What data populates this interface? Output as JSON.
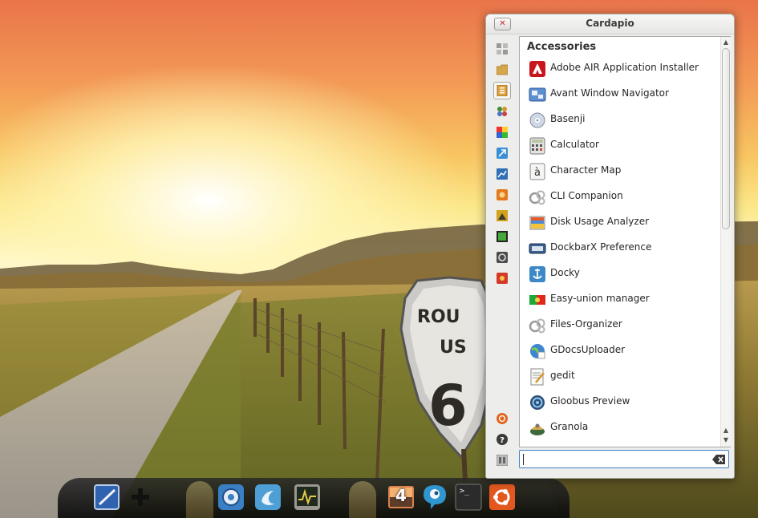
{
  "window": {
    "title": "Cardapio",
    "close_icon": "close-icon"
  },
  "categories": [
    {
      "name": "favorites",
      "icon": "favorites-icon"
    },
    {
      "name": "places",
      "icon": "folder-icon"
    },
    {
      "name": "accessories",
      "icon": "accessories-icon",
      "active": true
    },
    {
      "name": "education",
      "icon": "education-icon"
    },
    {
      "name": "graphics",
      "icon": "graphics-icon"
    },
    {
      "name": "internet",
      "icon": "internet-icon"
    },
    {
      "name": "office",
      "icon": "office-icon"
    },
    {
      "name": "programming",
      "icon": "programming-icon"
    },
    {
      "name": "science",
      "icon": "science-icon"
    },
    {
      "name": "sound-video",
      "icon": "sound-video-icon"
    },
    {
      "name": "system-tools",
      "icon": "system-tools-icon"
    },
    {
      "name": "other",
      "icon": "other-icon"
    }
  ],
  "bottom_buttons": [
    {
      "name": "ubuntu",
      "icon": "ubuntu-icon"
    },
    {
      "name": "help",
      "icon": "help-icon"
    },
    {
      "name": "settings",
      "icon": "settings-icon"
    }
  ],
  "section": {
    "title": "Accessories"
  },
  "apps": [
    {
      "label": "Adobe AIR Application Installer",
      "icon": "adobe-air-icon"
    },
    {
      "label": "Avant Window Navigator",
      "icon": "avant-icon"
    },
    {
      "label": "Basenji",
      "icon": "basenji-icon"
    },
    {
      "label": "Calculator",
      "icon": "calculator-icon"
    },
    {
      "label": "Character Map",
      "icon": "character-map-icon"
    },
    {
      "label": "CLI Companion",
      "icon": "cli-companion-icon"
    },
    {
      "label": "Disk Usage Analyzer",
      "icon": "disk-usage-icon"
    },
    {
      "label": "DockbarX Preference",
      "icon": "dockbarx-icon"
    },
    {
      "label": "Docky",
      "icon": "docky-icon"
    },
    {
      "label": "Easy-union manager",
      "icon": "easy-union-icon"
    },
    {
      "label": "Files-Organizer",
      "icon": "files-organizer-icon"
    },
    {
      "label": "GDocsUploader",
      "icon": "gdocs-icon"
    },
    {
      "label": "gedit",
      "icon": "gedit-icon"
    },
    {
      "label": "Gloobus Preview",
      "icon": "gloobus-icon"
    },
    {
      "label": "Granola",
      "icon": "granola-icon"
    }
  ],
  "search": {
    "value": "",
    "clear_icon": "clear-icon"
  },
  "dock": [
    {
      "name": "drawing-app",
      "icon": "drawing-app-icon"
    },
    {
      "name": "add-launcher",
      "icon": "plus-icon"
    },
    {
      "name": "web-browser",
      "icon": "browser-icon"
    },
    {
      "name": "blender",
      "icon": "blender-icon"
    },
    {
      "name": "system-monitor",
      "icon": "system-monitor-icon"
    },
    {
      "name": "workspace",
      "icon": "workspace-icon",
      "badge": "4"
    },
    {
      "name": "chat",
      "icon": "chat-icon"
    },
    {
      "name": "terminal",
      "icon": "terminal-icon",
      "glyph": ">_"
    },
    {
      "name": "ubuntu-menu",
      "icon": "ubuntu-logo-icon"
    }
  ]
}
